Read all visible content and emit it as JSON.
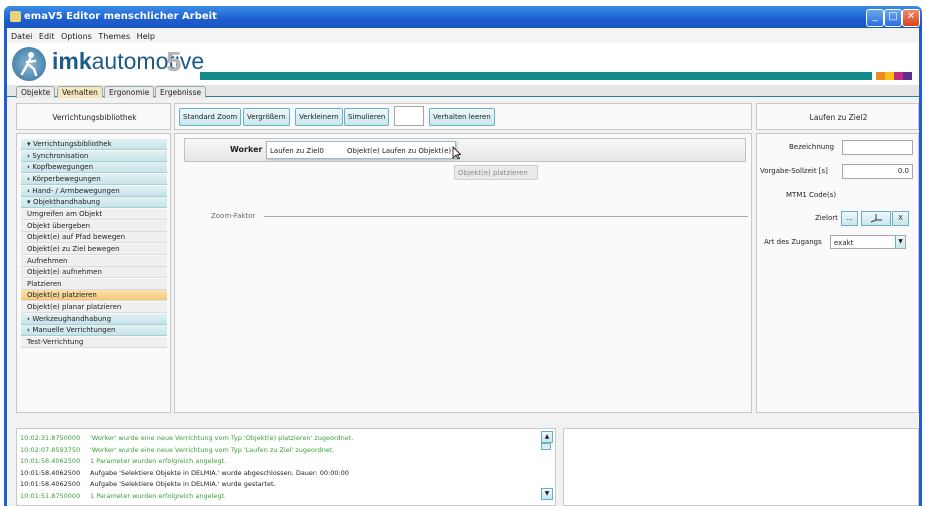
{
  "window": {
    "title": "emaV5 Editor menschlicher Arbeit"
  },
  "menu": [
    "Datei",
    "Edit",
    "Options",
    "Themes",
    "Help"
  ],
  "brand": {
    "name_bold": "imk",
    "name_thin": "automotive",
    "mark": "5",
    "teal": "#138a8a"
  },
  "tabs": [
    {
      "label": "Objekte"
    },
    {
      "label": "Verhalten",
      "active": true
    },
    {
      "label": "Ergonomie"
    },
    {
      "label": "Ergebnisse"
    }
  ],
  "left_panel": {
    "title": "Verrichtungsbibliothek",
    "items": [
      {
        "label": "Verrichtungsbibliothek",
        "kind": "group",
        "expanded": true
      },
      {
        "label": "Synchronisation",
        "kind": "group"
      },
      {
        "label": "Kopfbewegungen",
        "kind": "group"
      },
      {
        "label": "Körperbewegungen",
        "kind": "group"
      },
      {
        "label": "Hand- / Armbewegungen",
        "kind": "group"
      },
      {
        "label": "Objekthandhabung",
        "kind": "group",
        "expanded": true
      },
      {
        "label": "Umgreifen am Objekt",
        "kind": "leaf"
      },
      {
        "label": "Objekt übergeben",
        "kind": "leaf"
      },
      {
        "label": "Objekt(e) auf Pfad bewegen",
        "kind": "leaf"
      },
      {
        "label": "Objekt(e) zu Ziel bewegen",
        "kind": "leaf"
      },
      {
        "label": "Aufnehmen",
        "kind": "leaf"
      },
      {
        "label": "Objekt(e) aufnehmen",
        "kind": "leaf"
      },
      {
        "label": "Platzieren",
        "kind": "leaf"
      },
      {
        "label": "Objekt(e) platzieren",
        "kind": "leaf",
        "selected": true
      },
      {
        "label": "Objekt(e) planar platzieren",
        "kind": "leaf"
      },
      {
        "label": "Werkzeughandhabung",
        "kind": "group"
      },
      {
        "label": "Manuelle Verrichtungen",
        "kind": "group"
      },
      {
        "label": "Test-Verrichtung",
        "kind": "leaf"
      }
    ]
  },
  "toolbar": {
    "standard_zoom": "Standard Zoom",
    "zoom_in": "Vergrößern",
    "zoom_out": "Verkleinern",
    "simulate": "Simulieren",
    "clear": "Verhalten leeren"
  },
  "canvas": {
    "worker_label": "Worker",
    "chain_item_1": "Laufen zu Ziel0",
    "chain_item_2": "Objekt(e) Laufen zu Objekt(e)",
    "drag_ghost": "Objekt(e) platzieren",
    "zoom_label": "Zoom-Faktor"
  },
  "right_panel": {
    "title": "Laufen zu Ziel2",
    "bezeichnung_label": "Bezeichnung",
    "bezeichnung_value": "",
    "sollzeit_label": "Vorgabe-Sollzeit [s]",
    "sollzeit_value": "0.0",
    "mtm_label": "MTM1 Code(s)",
    "zielort_label": "Zielort",
    "zielort_btn_browse": "...",
    "zielort_btn_clear": "X",
    "zugang_label": "Art des Zugangs",
    "zugang_value": "exakt"
  },
  "log": [
    {
      "time": "10:02:31.8750000",
      "text": "'Worker' wurde eine neue Verrichtung vom Typ 'Objekt(e) platzieren' zugeordnet.",
      "color": "green"
    },
    {
      "time": "10:02:07.8593750",
      "text": "'Worker' wurde eine neue Verrichtung vom Typ 'Laufen zu Ziel' zugeordnet.",
      "color": "green"
    },
    {
      "time": "10:01:58.4062500",
      "text": "1 Parameter wurden erfolgreich angelegt.",
      "color": "green"
    },
    {
      "time": "10:01:58.4062500",
      "text": "Aufgabe 'Selektiere Objekte in DELMIA.' wurde abgeschlossen. Dauer: 00:00:00",
      "color": "black"
    },
    {
      "time": "10:01:58.4062500",
      "text": "Aufgabe 'Selektiere Objekte in DELMIA.' wurde gestartet.",
      "color": "black"
    },
    {
      "time": "10:01:51.8750000",
      "text": "1 Parameter wurden erfolgreich angelegt.",
      "color": "green"
    }
  ]
}
